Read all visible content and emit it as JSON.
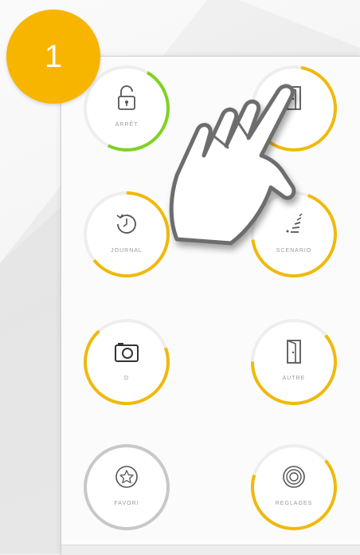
{
  "step_badge": {
    "number": "1",
    "color": "#f7b500"
  },
  "tiles": [
    {
      "label": "ARRÊT",
      "icon": "lock-open-icon",
      "ring_color": "#7ed321"
    },
    {
      "label": "",
      "icon": "door-icon",
      "ring_color": "#f0b90b"
    },
    {
      "label": "JOURNAL",
      "icon": "history-icon",
      "ring_color": "#f0b90b"
    },
    {
      "label": "SCENARIO",
      "icon": "scenario-icon",
      "ring_color": "#f0b90b"
    },
    {
      "label": "D",
      "icon": "camera-icon",
      "ring_color": "#f0b90b"
    },
    {
      "label": "AUTRE",
      "icon": "door-icon",
      "ring_color": "#f0b90b"
    },
    {
      "label": "FAVORI",
      "icon": "star-icon",
      "ring_color": "#c8c8c8"
    },
    {
      "label": "REGLAGES",
      "icon": "settings-icon",
      "ring_color": "#f0b90b"
    }
  ],
  "pointer": {
    "icon": "hand-pointer-icon"
  }
}
